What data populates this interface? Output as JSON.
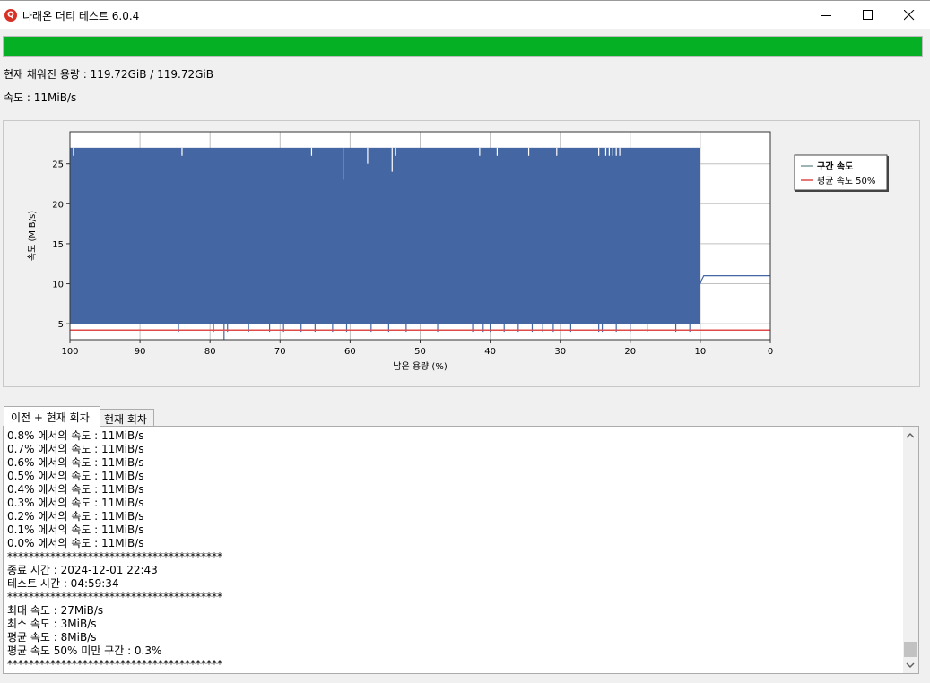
{
  "window": {
    "app_icon_letter": "Q",
    "title": "나래온 더티 테스트 6.0.4"
  },
  "progress": {
    "fraction": 1.0,
    "color": "#06b025"
  },
  "status": {
    "filled_capacity": "현재 채워진 용량 : 119.72GiB / 119.72GiB",
    "speed": "속도 : 11MiB/s"
  },
  "chart_data": {
    "type": "area",
    "xlabel": "남은 용량 (%)",
    "ylabel": "속도 (MiB/s)",
    "xlim": [
      100,
      0
    ],
    "ylim": [
      3,
      29
    ],
    "x_ticks": [
      100,
      90,
      80,
      70,
      60,
      50,
      40,
      30,
      20,
      10,
      0
    ],
    "y_ticks": [
      5,
      10,
      15,
      20,
      25
    ],
    "grid": true,
    "legend_position": "right",
    "series": [
      {
        "name": "구간 속도",
        "color": "#4466a3",
        "band_x": [
          100,
          10
        ],
        "band_y": [
          5,
          27
        ],
        "min_spikes": [
          {
            "x": 84.5,
            "y": 4
          },
          {
            "x": 79.5,
            "y": 4
          },
          {
            "x": 78,
            "y": 3
          },
          {
            "x": 77.5,
            "y": 4
          },
          {
            "x": 74.5,
            "y": 4
          },
          {
            "x": 71.5,
            "y": 4
          },
          {
            "x": 69.5,
            "y": 4
          },
          {
            "x": 67,
            "y": 4
          },
          {
            "x": 65,
            "y": 4
          },
          {
            "x": 62.5,
            "y": 4
          },
          {
            "x": 60.5,
            "y": 4
          },
          {
            "x": 57,
            "y": 4
          },
          {
            "x": 54.5,
            "y": 4
          },
          {
            "x": 52,
            "y": 4
          },
          {
            "x": 47.5,
            "y": 4
          },
          {
            "x": 42.5,
            "y": 4
          },
          {
            "x": 41,
            "y": 4
          },
          {
            "x": 40,
            "y": 4
          },
          {
            "x": 38,
            "y": 4
          },
          {
            "x": 36,
            "y": 4
          },
          {
            "x": 34,
            "y": 4
          },
          {
            "x": 32.5,
            "y": 4
          },
          {
            "x": 31,
            "y": 4
          },
          {
            "x": 28.5,
            "y": 4
          },
          {
            "x": 24.5,
            "y": 4
          },
          {
            "x": 24,
            "y": 4
          },
          {
            "x": 22,
            "y": 4
          },
          {
            "x": 20,
            "y": 4
          },
          {
            "x": 17.5,
            "y": 4
          },
          {
            "x": 13.5,
            "y": 4
          },
          {
            "x": 11.5,
            "y": 4
          }
        ],
        "max_dips": [
          {
            "x": 99.5,
            "y": 26
          },
          {
            "x": 84,
            "y": 26
          },
          {
            "x": 65.5,
            "y": 26
          },
          {
            "x": 61,
            "y": 23
          },
          {
            "x": 57.5,
            "y": 25
          },
          {
            "x": 54,
            "y": 24
          },
          {
            "x": 53.5,
            "y": 26
          },
          {
            "x": 41.5,
            "y": 26
          },
          {
            "x": 39,
            "y": 26
          },
          {
            "x": 34.5,
            "y": 26
          },
          {
            "x": 30.5,
            "y": 26
          },
          {
            "x": 24.5,
            "y": 26
          },
          {
            "x": 23.5,
            "y": 26
          },
          {
            "x": 23,
            "y": 26
          },
          {
            "x": 22.5,
            "y": 26
          },
          {
            "x": 22,
            "y": 26
          },
          {
            "x": 21.5,
            "y": 26
          }
        ],
        "tail": [
          {
            "x": 10,
            "y": 10
          },
          {
            "x": 9.8,
            "y": 10.5
          },
          {
            "x": 9.5,
            "y": 11
          },
          {
            "x": 0,
            "y": 11
          }
        ]
      },
      {
        "name": "평균 속도 50%",
        "color": "#e04b4b",
        "y": 4.2
      }
    ]
  },
  "tabs": [
    {
      "label": "이전 + 현재 회차",
      "active": true
    },
    {
      "label": "현재 회차",
      "active": false
    }
  ],
  "log": [
    "0.8% 에서의 속도 : 11MiB/s",
    "0.7% 에서의 속도 : 11MiB/s",
    "0.6% 에서의 속도 : 11MiB/s",
    "0.5% 에서의 속도 : 11MiB/s",
    "0.4% 에서의 속도 : 11MiB/s",
    "0.3% 에서의 속도 : 11MiB/s",
    "0.2% 에서의 속도 : 11MiB/s",
    "0.1% 에서의 속도 : 11MiB/s",
    "0.0% 에서의 속도 : 11MiB/s",
    "****************************************",
    "종료 시간 : 2024-12-01 22:43",
    "테스트 시간 : 04:59:34",
    "****************************************",
    "최대 속도 : 27MiB/s",
    "최소 속도 : 3MiB/s",
    "평균 속도 : 8MiB/s",
    "평균 속도 50% 미만 구간 : 0.3%",
    "****************************************"
  ]
}
